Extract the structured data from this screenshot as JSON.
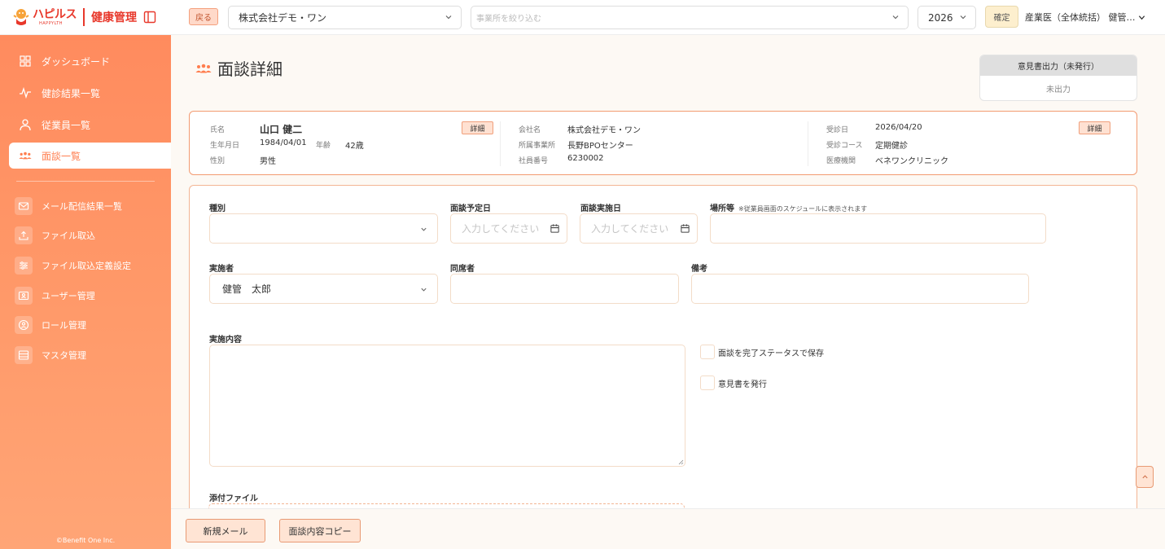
{
  "header": {
    "brand_name": "ハピルス",
    "brand_sub": "HAPPYLTH",
    "app_name": "健康管理",
    "back_label": "戻る",
    "company_select": {
      "value": "株式会社デモ・ワン"
    },
    "office_filter": {
      "placeholder": "事業所を絞り込む"
    },
    "year_select": {
      "value": "2026"
    },
    "confirm_label": "確定",
    "role_select": {
      "value": "産業医（全体統括） 健管…"
    }
  },
  "sidebar": {
    "items": [
      {
        "label": "ダッシュボード",
        "icon": "grid-icon"
      },
      {
        "label": "健診結果一覧",
        "icon": "pulse-icon"
      },
      {
        "label": "従業員一覧",
        "icon": "user-icon"
      },
      {
        "label": "面談一覧",
        "icon": "people-icon",
        "active": true
      }
    ],
    "sub_items": [
      {
        "label": "メール配信結果一覧",
        "icon": "mail-icon"
      },
      {
        "label": "ファイル取込",
        "icon": "upload-icon"
      },
      {
        "label": "ファイル取込定義設定",
        "icon": "sliders-icon"
      },
      {
        "label": "ユーザー管理",
        "icon": "id-card-icon"
      },
      {
        "label": "ロール管理",
        "icon": "role-icon"
      },
      {
        "label": "マスタ管理",
        "icon": "table-icon"
      }
    ],
    "copyright": "©Benefit One Inc."
  },
  "page": {
    "title": "面談詳細",
    "opinion": {
      "header": "意見書出力（未発行）",
      "status": "未出力"
    }
  },
  "employee": {
    "name_label": "氏名",
    "name": "山口 健二",
    "birth_label": "生年月日",
    "birth": "1984/04/01",
    "age_label": "年齢",
    "age": "42歳",
    "gender_label": "性別",
    "gender": "男性",
    "detail_label": "詳細"
  },
  "company": {
    "company_label": "会社名",
    "company": "株式会社デモ・ワン",
    "office_label": "所属事業所",
    "office": "長野BPOセンター",
    "employee_no_label": "社員番号",
    "employee_no": "6230002"
  },
  "exam": {
    "date_label": "受診日",
    "date": "2026/04/20",
    "course_label": "受診コース",
    "course": "定期健診",
    "clinic_label": "医療機関",
    "clinic": "ベネワンクリニック",
    "detail_label": "詳細"
  },
  "form": {
    "type": {
      "label": "種別",
      "value": ""
    },
    "scheduled_date": {
      "label": "面談予定日",
      "placeholder": "入力してください"
    },
    "actual_date": {
      "label": "面談実施日",
      "placeholder": "入力してください"
    },
    "location": {
      "label": "場所等",
      "note": "※従業員画面のスケジュールに表示されます",
      "value": ""
    },
    "conductor": {
      "label": "実施者",
      "value": "健管　太郎"
    },
    "attendee": {
      "label": "同席者",
      "value": ""
    },
    "remarks": {
      "label": "備考",
      "value": ""
    },
    "content": {
      "label": "実施内容",
      "value": ""
    },
    "complete_checkbox": {
      "label": "面談を完了ステータスで保存",
      "checked": false
    },
    "issue_opinion_checkbox": {
      "label": "意見書を発行",
      "checked": false
    },
    "attachment": {
      "label": "添付ファイル"
    }
  },
  "bottom": {
    "new_mail_label": "新規メール",
    "copy_label": "面談内容コピー"
  },
  "colors": {
    "brand_red": "#e8382b",
    "sidebar_orange": "#ff8b5e",
    "accent_border": "#f39b72",
    "background": "#fdf9f4"
  }
}
